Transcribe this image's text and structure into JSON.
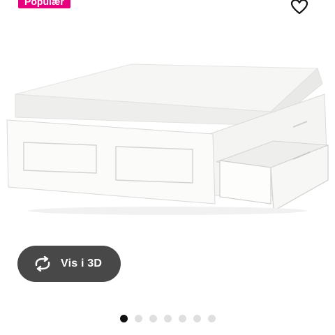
{
  "badge": {
    "text": "Populær"
  },
  "favorite": {
    "icon": "heart-outline-icon"
  },
  "product": {
    "image_icon": "bed-frame-with-drawer-image"
  },
  "view3d": {
    "label": "Vis i 3D",
    "icon": "rotate-3d-icon"
  },
  "carousel": {
    "total": 7,
    "active_index": 0
  },
  "colors": {
    "badge": "#e6007e",
    "button": "#484848",
    "dot_active": "#111111",
    "dot_inactive": "#dfdfdf"
  }
}
